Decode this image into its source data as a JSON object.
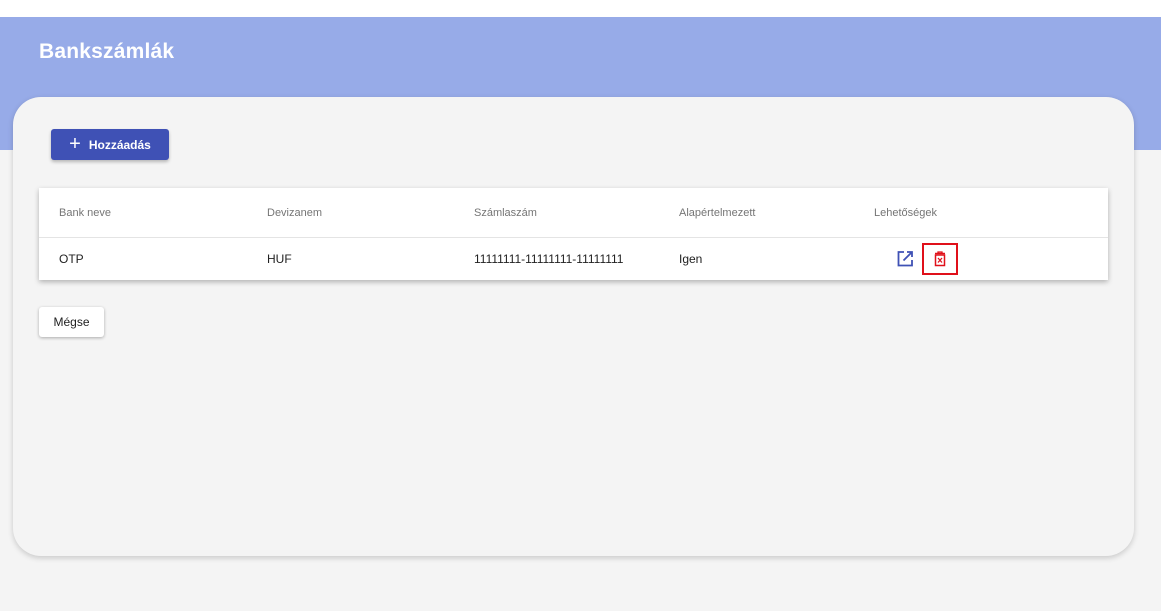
{
  "page": {
    "title": "Bankszámlák"
  },
  "toolbar": {
    "add_label": "Hozzáadás",
    "add_icon": "plus-icon"
  },
  "table": {
    "headers": [
      "Bank neve",
      "Devizanem",
      "Számlaszám",
      "Alapértelmezett",
      "Lehetőségek"
    ],
    "rows": [
      {
        "bank": "OTP",
        "currency": "HUF",
        "account": "11111111-11111111-11111111",
        "default": "Igen"
      }
    ],
    "actions": [
      {
        "icon": "edit-icon",
        "color": "#3f51b5"
      },
      {
        "icon": "delete-icon",
        "color": "#e0101a",
        "highlighted": true
      }
    ]
  },
  "footer": {
    "cancel_label": "Mégse"
  },
  "colors": {
    "header": "#97abe8",
    "primary": "#3f51b5",
    "danger": "#e0101a",
    "background": "#f4f4f4"
  }
}
